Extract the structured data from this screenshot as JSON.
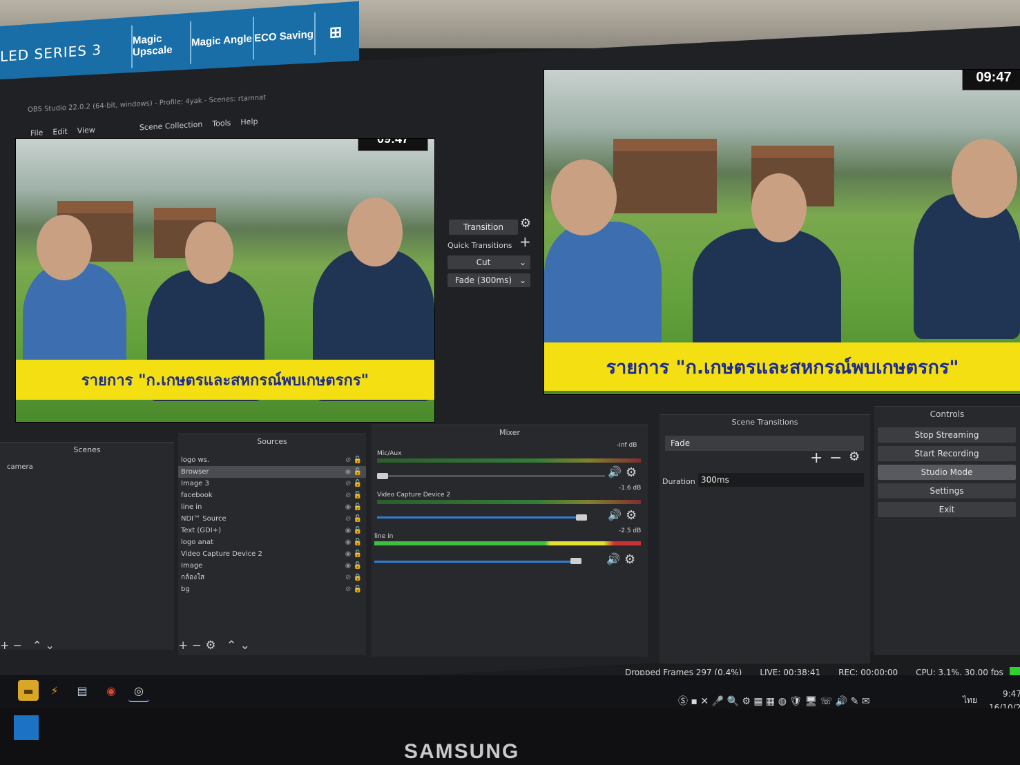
{
  "monitor": {
    "series_logo": "LED SERIES 3",
    "stickers": [
      "Magic Upscale",
      "Magic Angle",
      "ECO Saving"
    ],
    "brand": "SAMSUNG"
  },
  "window": {
    "title": "OBS Studio 22.0.2 (64-bit, windows) - Profile: 4yak - Scenes: rtamnat",
    "menu": [
      "File",
      "Edit",
      "View",
      "Scene Collection",
      "Tools",
      "Help"
    ]
  },
  "preview": {
    "clock": "09:47",
    "banner": "รายการ \"ก.เกษตรและสหกรณ์พบเกษตรกร\""
  },
  "program": {
    "clock": "09:47",
    "banner": "รายการ \"ก.เกษตรและสหกรณ์พบเกษตรกร\""
  },
  "transition_panel": {
    "transition_label": "Transition",
    "quick_transitions_label": "Quick Transitions",
    "cut_label": "Cut",
    "fade_label": "Fade (300ms)"
  },
  "scenes": {
    "title": "Scenes",
    "items": [
      "camera"
    ]
  },
  "sources": {
    "title": "Sources",
    "items": [
      "logo ws.",
      "Browser",
      "Image 3",
      "facebook",
      "line in",
      "NDI™ Source",
      "Text (GDI+)",
      "logo anat",
      "Video Capture Device 2",
      "Image",
      "กล้องใส",
      "bg"
    ]
  },
  "mixer": {
    "title": "Mixer",
    "channels": [
      {
        "name": "Mic/Aux",
        "db": "-inf dB",
        "level": 0.0
      },
      {
        "name": "Video Capture Device 2",
        "db": "-1.6 dB",
        "level": 0.78
      },
      {
        "name": "line in",
        "db": "-2.5 dB",
        "level": 0.76
      }
    ]
  },
  "scene_transitions": {
    "title": "Scene Transitions",
    "selected": "Fade",
    "duration_label": "Duration",
    "duration_value": "300ms"
  },
  "controls": {
    "title": "Controls",
    "buttons": [
      "Stop Streaming",
      "Start Recording",
      "Studio Mode",
      "Settings",
      "Exit"
    ]
  },
  "status": {
    "dropped": "Dropped Frames 297 (0.4%)",
    "live": "LIVE: 00:38:41",
    "rec": "REC: 00:00:00",
    "cpu": "CPU: 3.1%, 30.00 fps"
  },
  "taskbar": {
    "time": "9:47",
    "date": "16/10/2",
    "lang": "ไทย"
  },
  "colors": {
    "banner_yellow": "#f4df12",
    "banner_text": "#1d2c8f",
    "slider_blue": "#2f7fd6",
    "panel_bg": "#28292c"
  }
}
